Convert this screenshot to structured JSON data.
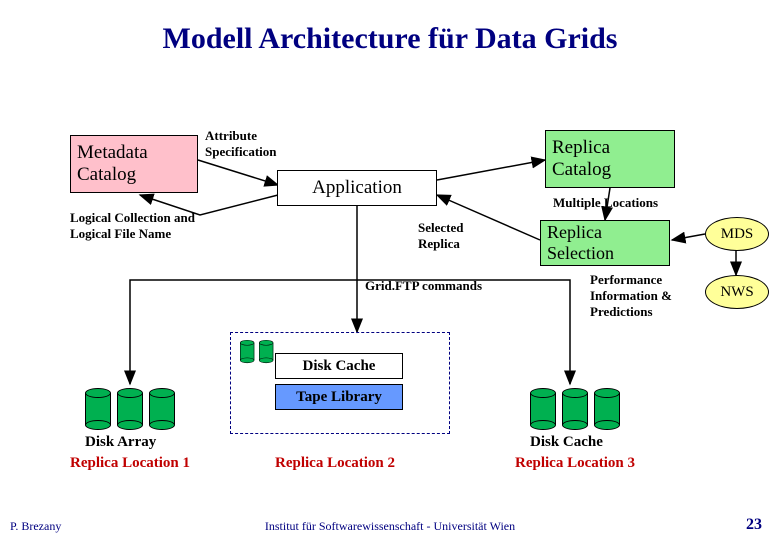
{
  "title": "Modell Architecture für Data Grids",
  "boxes": {
    "metadata": "Metadata\nCatalog",
    "replica_catalog": "Replica\nCatalog",
    "replica_selection": "Replica\nSelection",
    "application": "Application"
  },
  "ovals": {
    "mds": "MDS",
    "nws": "NWS"
  },
  "labels": {
    "attribute_spec": "Attribute\nSpecification",
    "logical_collection": "Logical Collection and\nLogical File Name",
    "multiple_locations": "Multiple Locations",
    "selected_replica": "Selected\nReplica",
    "gridftp": "Grid.FTP commands",
    "perf_info": "Performance\nInformation &\nPredictions"
  },
  "storage": {
    "disk_cache": "Disk Cache",
    "tape_library": "Tape Library",
    "disk_array": "Disk Array",
    "disk_cache2": "Disk Cache",
    "rep1": "Replica Location 1",
    "rep2": "Replica Location 2",
    "rep3": "Replica Location 3"
  },
  "footer": {
    "author": "P. Brezany",
    "institute": "Institut für Softwarewissenschaft - Universität Wien",
    "page": "23"
  }
}
